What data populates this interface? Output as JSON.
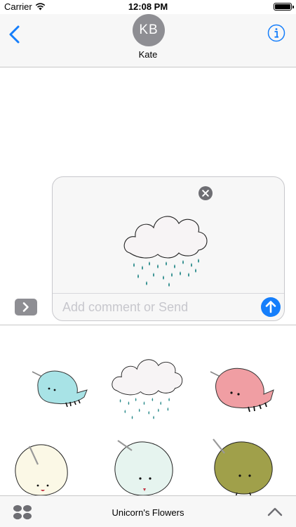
{
  "status_bar": {
    "carrier": "Carrier",
    "time": "12:08 PM"
  },
  "header": {
    "contact_initials": "KB",
    "contact_name": "Kate"
  },
  "compose": {
    "placeholder": "Add comment or Send",
    "selected_sticker": "rain-cloud"
  },
  "sticker_browser": {
    "stickers": [
      "blue-narwhal",
      "rain-cloud",
      "pink-narwhal",
      "cream-unicorn",
      "mint-unicorn",
      "olive-unicorn"
    ]
  },
  "bottom_bar": {
    "app_name": "Unicorn's Flowers"
  },
  "colors": {
    "accent": "#157efb",
    "avatar": "#8e8e93",
    "bar_bg": "#f7f7f7"
  }
}
